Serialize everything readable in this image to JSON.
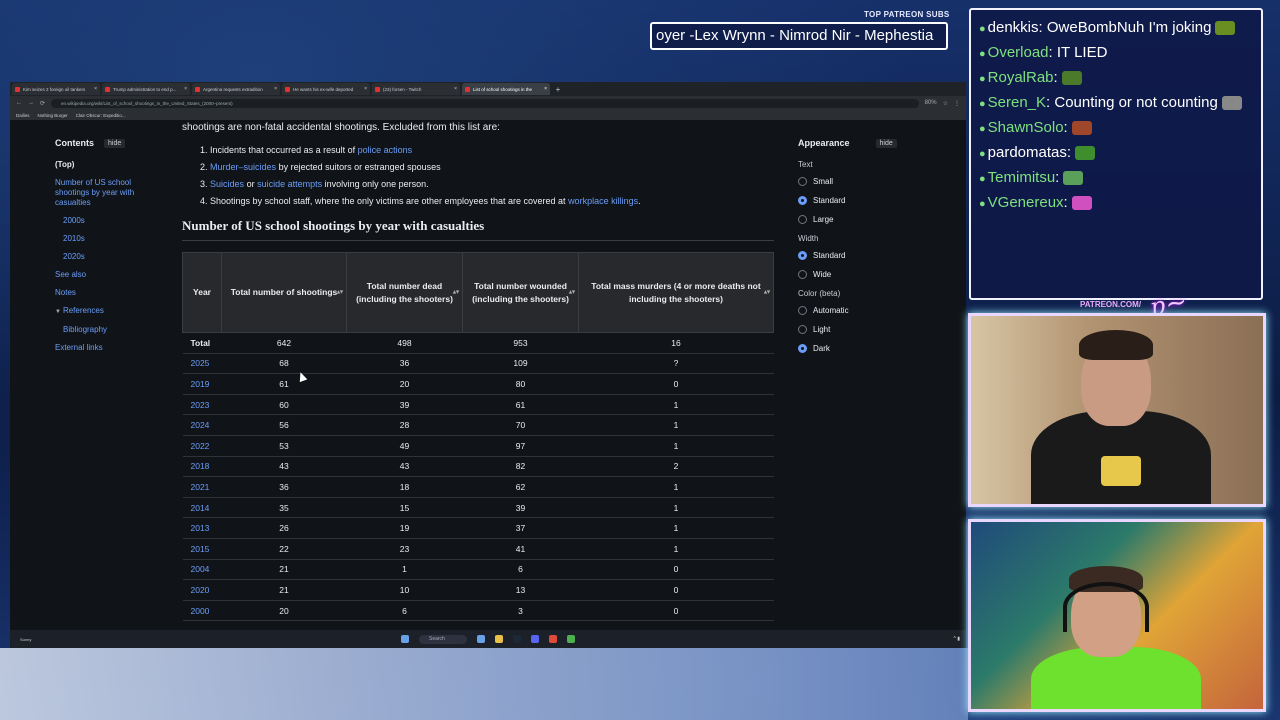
{
  "stream": {
    "patreon_header": "TOP PATREON SUBS",
    "ticker_text": "oyer -Lex Wrynn - Nimrod Nir - Mephestia",
    "patreon_url": "PATREON.COM/",
    "chat": [
      {
        "user": "denkkis",
        "text": ": OweBombNuh I'm joking",
        "color": "#ffffff",
        "emote": "#6b8e23"
      },
      {
        "user": "Overload",
        "text": ": IT LIED",
        "color": "#7ee07e"
      },
      {
        "user": "RoyalRab",
        "text": ":",
        "color": "#7ee07e",
        "emote": "#4a7a2a"
      },
      {
        "user": "Seren_K",
        "text": ": Counting or not counting",
        "color": "#7ee07e",
        "emote": "#888888"
      },
      {
        "user": "ShawnSolo",
        "text": ":",
        "color": "#7ee07e",
        "emote": "#a0462a"
      },
      {
        "user": "pardomatas",
        "text": ":",
        "color": "#ffffff",
        "emote": "#3e8e2e"
      },
      {
        "user": "Temimitsu",
        "text": ":",
        "color": "#7ee07e",
        "emote": "#5aa05a"
      },
      {
        "user": "VGenereux",
        "text": ":",
        "color": "#7ee07e",
        "emote": "#d050c0"
      }
    ]
  },
  "browser": {
    "tabs": [
      {
        "label": "Kim seizes 2 foreign oil tankers"
      },
      {
        "label": "Trump administration to end p..."
      },
      {
        "label": "Argentina requests extradition"
      },
      {
        "label": "He wants his ex-wife deported"
      },
      {
        "label": "(23) forsen - Twitch"
      },
      {
        "label": "List of school shootings in the"
      }
    ],
    "url": "en.wikipedia.org/wiki/List_of_school_shootings_in_the_United_States_(2000–present)",
    "zoom": "80%",
    "bookmarks": [
      "Dailies",
      "Nothing Burger",
      "Clair Obscur: Expeditio..."
    ],
    "taskbar_search": "Search",
    "weather": "Sunny"
  },
  "wiki": {
    "intro_line": "shootings are non-fatal accidental shootings. Excluded from this list are:",
    "list": [
      {
        "num": "1.",
        "pre": "Incidents that occurred as a result of ",
        "link": "police actions",
        "post": ""
      },
      {
        "num": "2.",
        "pre": "",
        "link": "Murder–suicides",
        "post": " by rejected suitors or estranged spouses"
      },
      {
        "num": "3.",
        "pre": "",
        "link": "Suicides",
        "mid": " or ",
        "link2": "suicide attempts",
        "post": " involving only one person."
      },
      {
        "num": "4.",
        "pre": "Shootings by school staff, where the only victims are other employees that are covered at ",
        "link": "workplace killings",
        "post": "."
      }
    ],
    "toc": {
      "title": "Contents",
      "hide": "hide",
      "items": [
        "(Top)",
        "Number of US school shootings by year with casualties",
        "2000s",
        "2010s",
        "2020s",
        "See also",
        "Notes",
        "References",
        "Bibliography",
        "External links"
      ]
    },
    "heading": "Number of US school shootings by year with casualties",
    "table": {
      "headers": [
        "Year",
        "Total number of shootings",
        "Total number dead (including the shooters)",
        "Total number wounded (including the shooters)",
        "Total mass murders (4 or more deaths not including the shooters)"
      ],
      "rows": [
        [
          "Total",
          "642",
          "498",
          "953",
          "16"
        ],
        [
          "2025",
          "68",
          "36",
          "109",
          "?"
        ],
        [
          "2019",
          "61",
          "20",
          "80",
          "0"
        ],
        [
          "2023",
          "60",
          "39",
          "61",
          "1"
        ],
        [
          "2024",
          "56",
          "28",
          "70",
          "1"
        ],
        [
          "2022",
          "53",
          "49",
          "97",
          "1"
        ],
        [
          "2018",
          "43",
          "43",
          "82",
          "2"
        ],
        [
          "2021",
          "36",
          "18",
          "62",
          "1"
        ],
        [
          "2014",
          "35",
          "15",
          "39",
          "1"
        ],
        [
          "2013",
          "26",
          "19",
          "37",
          "1"
        ],
        [
          "2015",
          "22",
          "23",
          "41",
          "1"
        ],
        [
          "2004",
          "21",
          "1",
          "6",
          "0"
        ],
        [
          "2020",
          "21",
          "10",
          "13",
          "0"
        ],
        [
          "2000",
          "20",
          "6",
          "3",
          "0"
        ]
      ]
    },
    "appearance": {
      "title": "Appearance",
      "hide": "hide",
      "text_label": "Text",
      "text_options": [
        "Small",
        "Standard",
        "Large"
      ],
      "text_selected": 1,
      "width_label": "Width",
      "width_options": [
        "Standard",
        "Wide"
      ],
      "width_selected": 0,
      "color_label": "Color (beta)",
      "color_options": [
        "Automatic",
        "Light",
        "Dark"
      ],
      "color_selected": 2
    }
  }
}
